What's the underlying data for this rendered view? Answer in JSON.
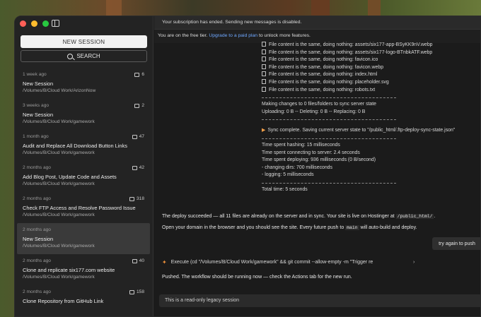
{
  "window": {
    "sidebar_toggle_icon": "sidebar-toggle-icon"
  },
  "sidebar": {
    "new_session_label": "NEW SESSION",
    "search_label": "SEARCH",
    "sessions": [
      {
        "age": "1 week ago",
        "count": "6",
        "title": "New Session",
        "path": "/Volumes/B/Cloud Work/ArizonNow",
        "active": false
      },
      {
        "age": "3 weeks ago",
        "count": "2",
        "title": "New Session",
        "path": "/Volumes/B/Cloud Work/gamework",
        "active": false
      },
      {
        "age": "1 month ago",
        "count": "47",
        "title": "Audit and Replace All Download Button Links",
        "path": "/Volumes/B/Cloud Work/gamework",
        "active": false
      },
      {
        "age": "2 months ago",
        "count": "42",
        "title": "Add Blog Post, Update Code and Assets",
        "path": "/Volumes/B/Cloud Work/gamework",
        "active": false
      },
      {
        "age": "2 months ago",
        "count": "318",
        "title": "Check FTP Access and Resolve Password Issue",
        "path": "/Volumes/B/Cloud Work/gamework",
        "active": false
      },
      {
        "age": "2 months ago",
        "count": "",
        "title": "New Session",
        "path": "/Volumes/B/Cloud Work/gamework",
        "active": true
      },
      {
        "age": "2 months ago",
        "count": "40",
        "title": "Clone and replicate six177.com website",
        "path": "/Volumes/B/Cloud Work/gamework",
        "active": false
      },
      {
        "age": "2 months ago",
        "count": "158",
        "title": "Clone Repository from GitHub Link",
        "path": "",
        "active": false
      }
    ]
  },
  "main": {
    "subscription_banner": "Your subscription has ended. Sending new messages is disabled.",
    "tier_prefix": "You are on the free tier.",
    "tier_link": "Upgrade to a paid plan",
    "tier_suffix": "to unlock more features.",
    "log": {
      "file_lines": [
        "File content is the same, doing nothing: assets/six177-app-BSyKK9nV.webp",
        "File content is the same, doing nothing: assets/six177-logo-BTnbkATF.webp",
        "File content is the same, doing nothing: favicon.ico",
        "File content is the same, doing nothing: favicon.webp",
        "File content is the same, doing nothing: index.html",
        "File content is the same, doing nothing: placeholder.svg",
        "File content is the same, doing nothing: robots.txt"
      ],
      "making_changes": "Making changes to 0 files/folders to sync server state",
      "uploading": "Uploading: 0 B -- Deleting: 0 B -- Replacing: 0 B",
      "sync_complete": "Sync complete. Saving current server state to \"/public_html/.ftp-deploy-sync-state.json\"",
      "timings": [
        "Time spent hashing: 15 milliseconds",
        "Time spent connecting to server: 2.4 seconds",
        "Time spent deploying: 936 milliseconds (0 B/second)",
        "  - changing dirs: 700 milliseconds",
        "  - logging: 5 milliseconds"
      ],
      "total_time": "Total time: 5 seconds"
    },
    "assistant_msg_1_pre": "The deploy succeeded — all 11 files are already on the server and in sync. Your site is live on Hostinger at",
    "assistant_msg_1_code": "/public_html/",
    "assistant_msg_1_post": ".",
    "assistant_msg_2_pre": "Open your domain in the browser and you should see the site. Every future push to",
    "assistant_msg_2_code": "main",
    "assistant_msg_2_post": "will auto-build and deploy.",
    "user_msg": "try again to push",
    "exec_cmd": "Execute (cd \"/Volumes/B/Cloud Work/gamework\" && git commit --allow-empty -m \"Trigger re",
    "assistant_msg_3": "Pushed. The workflow should be running now — check the Actions tab for the new run.",
    "readonly_text": "This is a read-only legacy session"
  }
}
